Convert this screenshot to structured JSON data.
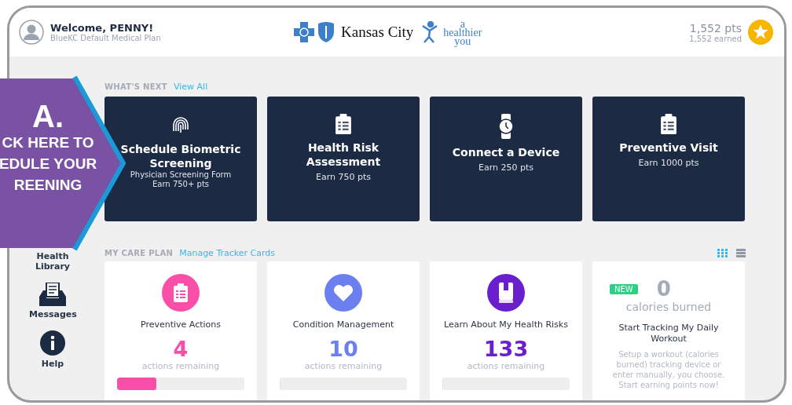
{
  "header": {
    "welcome": "Welcome, PENNY!",
    "plan": "BlueKC Default Medical Plan",
    "logo_text": "Kansas City",
    "tagline": [
      "a",
      "healthier",
      "you"
    ],
    "points": "1,552 pts",
    "earned": "1,552 earned"
  },
  "callout": {
    "letter": "A.",
    "lines": [
      "CK HERE TO",
      "EDULE YOUR",
      "REENING"
    ]
  },
  "sidebar": {
    "items": [
      {
        "label": "Health Library",
        "kind": "hidden"
      },
      {
        "label": "Messages",
        "kind": "inbox"
      },
      {
        "label": "Help",
        "kind": "info"
      }
    ]
  },
  "whats_next": {
    "title": "WHAT'S NEXT",
    "link": "View All",
    "cards": [
      {
        "kind": "fingerprint",
        "title": "Schedule Biometric Screening",
        "lines": [
          "Physician Screening Form",
          "Earn 750+ pts"
        ]
      },
      {
        "kind": "clipboard",
        "title": "Health Risk Assessment",
        "lines": [
          "Earn 750 pts"
        ]
      },
      {
        "kind": "watch",
        "title": "Connect a Device",
        "lines": [
          "Earn 250 pts"
        ]
      },
      {
        "kind": "clipboard",
        "title": "Preventive Visit",
        "lines": [
          "Earn 1000 pts"
        ]
      }
    ]
  },
  "care_plan": {
    "title": "MY CARE PLAN",
    "link": "Manage Tracker Cards",
    "views": [
      {
        "kind": "grid",
        "selected": true
      },
      {
        "kind": "list",
        "selected": false
      }
    ],
    "cards": [
      {
        "kind": "tracker",
        "color": "#f94fa8",
        "title": "Preventive Actions",
        "count": "4",
        "caption": "actions remaining",
        "level": 0.31
      },
      {
        "kind": "tracker",
        "color": "#6b7ff0",
        "title": "Condition Management",
        "count": "10",
        "caption": "actions remaining",
        "level": 0
      },
      {
        "kind": "tracker",
        "color": "#6a1fcf",
        "title": "Learn About My Health Risks",
        "count": "133",
        "caption": "actions remaining",
        "level": 0
      },
      {
        "kind": "workout",
        "badge": "NEW",
        "count": "0",
        "caption": "calories burned",
        "title": "Start Tracking My Daily Workout",
        "text": "Setup a workout (calories burned) tracking device or enter manually, you choose. Start earning points now!"
      }
    ]
  }
}
